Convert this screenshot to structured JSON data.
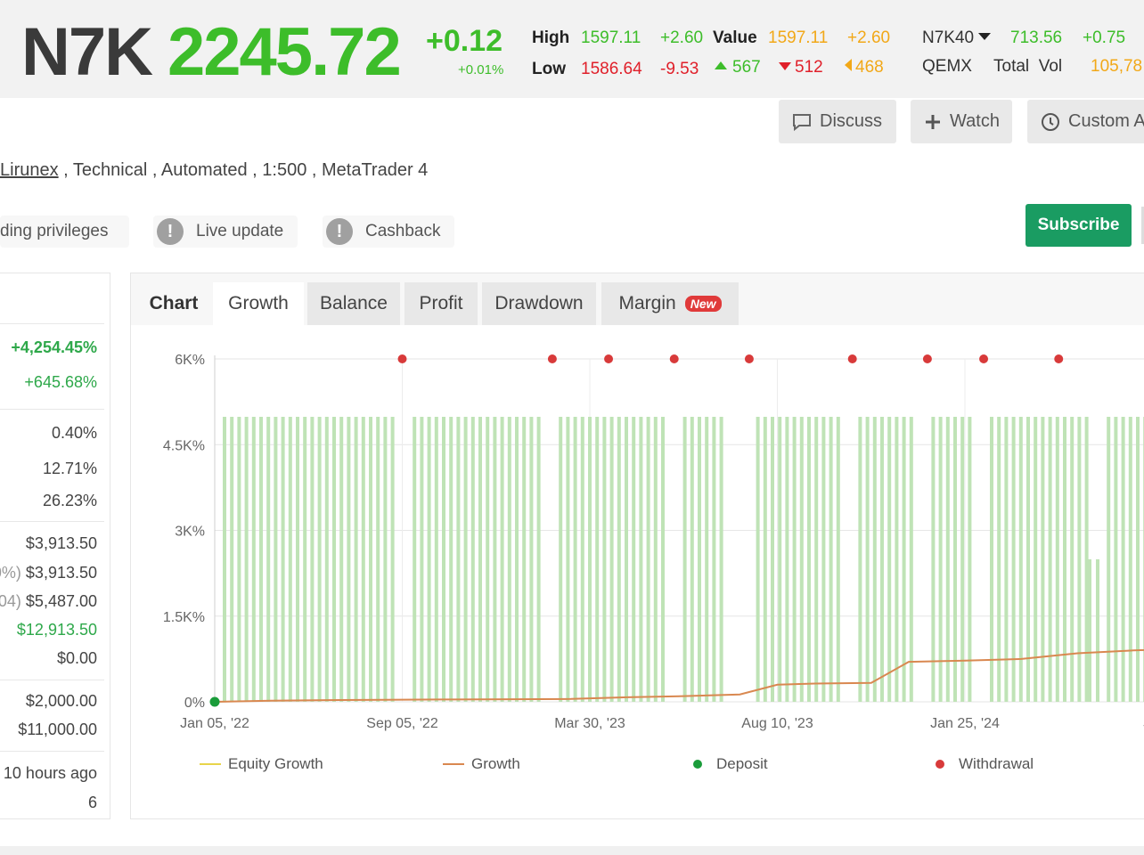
{
  "ticker": {
    "symbol": "N7K",
    "price": "2245.72",
    "change": "+0.12",
    "change_pct": "+0.01%",
    "high_label": "High",
    "high_value": "1597.11",
    "high_change": "+2.60",
    "value_label": "Value",
    "value_value": "1597.11",
    "value_change": "+2.60",
    "low_label": "Low",
    "low_value": "1586.64",
    "low_change": "-9.53",
    "advances": "567",
    "declines": "512",
    "unchanged": "468",
    "index_name": "N7K40",
    "index_value": "713.56",
    "index_change": "+0.75",
    "exchange": "QEMX",
    "total_vol_label": "Total  Vol",
    "total_vol_value": "105,78",
    "colors": {
      "up": "#3dbd2a",
      "down": "#e0202a",
      "neutral": "#f2a818"
    }
  },
  "actions": {
    "discuss": "Discuss",
    "watch": "Watch",
    "custom": "Custom A"
  },
  "account": {
    "broker": "Lirunex",
    "meta_rest": " , Technical , Automated , 1:500 , MetaTrader 4"
  },
  "badges": {
    "trading_privileges": "ding privileges",
    "live_update": "Live update",
    "cashback": "Cashback"
  },
  "subscribe_label": "Subscribe",
  "stats": {
    "gain": "+4,254.45%",
    "abs_gain": "+645.68%",
    "daily": "0.40%",
    "monthly": "12.71%",
    "drawdown": "26.23%",
    "balance": "$3,913.50",
    "equity_prefix": "0%)",
    "equity": "$3,913.50",
    "highest_prefix": "04)",
    "highest": "$5,487.00",
    "profit": "$12,913.50",
    "interest": "$0.00",
    "deposits": "$2,000.00",
    "withdrawals": "$11,000.00",
    "updated": "10 hours ago",
    "tracking": "6"
  },
  "tabs": {
    "chart": "Chart",
    "growth": "Growth",
    "balance": "Balance",
    "profit": "Profit",
    "drawdown": "Drawdown",
    "margin": "Margin",
    "margin_badge": "New"
  },
  "chart_data": {
    "type": "line",
    "y_ticks": [
      "6K%",
      "4.5K%",
      "3K%",
      "1.5K%",
      "0%"
    ],
    "x_ticks": [
      "Jan 05, '22",
      "Sep 05, '22",
      "Mar 30, '23",
      "Aug 10, '23",
      "Jan 25, '24",
      "Jul"
    ],
    "ylim": [
      0,
      6000
    ],
    "grid": true,
    "legend_position": "bottom",
    "series": [
      {
        "name": "Growth",
        "color": "#d98850",
        "points": [
          [
            0,
            0
          ],
          [
            0.3,
            20
          ],
          [
            0.6,
            30
          ],
          [
            0.9,
            35
          ],
          [
            1.2,
            40
          ],
          [
            1.6,
            45
          ],
          [
            1.9,
            50
          ],
          [
            2.2,
            80
          ],
          [
            2.5,
            100
          ],
          [
            2.8,
            130
          ],
          [
            3.0,
            300
          ],
          [
            3.2,
            320
          ],
          [
            3.5,
            330
          ],
          [
            3.7,
            700
          ],
          [
            4.0,
            720
          ],
          [
            4.3,
            750
          ],
          [
            4.6,
            850
          ],
          [
            4.9,
            900
          ],
          [
            5.2,
            940
          ],
          [
            5.5,
            1000
          ],
          [
            5.8,
            1100
          ],
          [
            6.1,
            1150
          ],
          [
            6.4,
            1400
          ],
          [
            6.7,
            1600
          ],
          [
            7.0,
            1700
          ],
          [
            7.3,
            1800
          ],
          [
            7.6,
            1980
          ],
          [
            7.9,
            2000
          ],
          [
            8.0,
            2100
          ],
          [
            8.3,
            2600
          ],
          [
            8.5,
            2900
          ],
          [
            8.7,
            3050
          ],
          [
            8.9,
            3400
          ],
          [
            9.1,
            3700
          ],
          [
            9.3,
            4150
          ],
          [
            9.45,
            4300
          ],
          [
            9.55,
            3800
          ],
          [
            9.65,
            3200
          ],
          [
            9.75,
            3300
          ],
          [
            9.85,
            3700
          ],
          [
            10.0,
            3850
          ],
          [
            10.2,
            4100
          ],
          [
            10.5,
            4400
          ],
          [
            10.7,
            4550
          ]
        ]
      },
      {
        "name": "Equity Growth",
        "color": "#e8d44a",
        "points": []
      },
      {
        "name": "Deposit",
        "color": "#1a9c3a",
        "points": [
          [
            0,
            0
          ]
        ]
      },
      {
        "name": "Withdrawal",
        "color": "#d83a3a",
        "points": [
          [
            1.0,
            6000
          ],
          [
            1.8,
            6000
          ],
          [
            2.1,
            6000
          ],
          [
            2.45,
            6000
          ],
          [
            2.85,
            6000
          ],
          [
            3.4,
            6000
          ],
          [
            3.8,
            6000
          ],
          [
            4.1,
            6000
          ],
          [
            4.5,
            6000
          ]
        ]
      }
    ],
    "legend": [
      "Equity Growth",
      "Growth",
      "Deposit",
      "Withdrawal"
    ]
  }
}
